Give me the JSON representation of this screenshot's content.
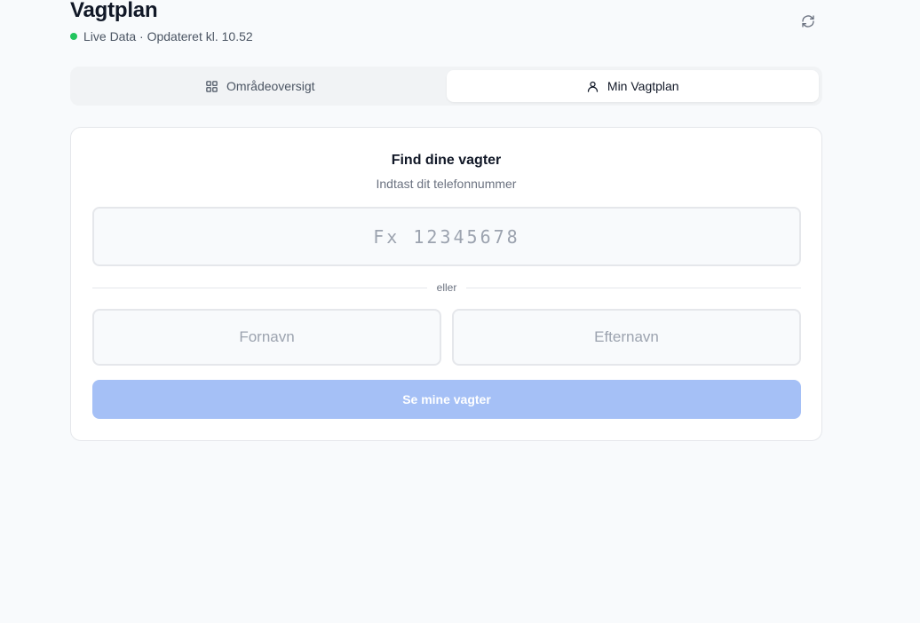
{
  "header": {
    "title": "Vagtplan",
    "status_text": "Live Data · Opdateret kl. 10.52",
    "status_color": "#22c55e",
    "refresh_icon": "refresh-icon"
  },
  "tabs": [
    {
      "label": "Områdeoversigt",
      "icon": "grid-icon",
      "active": false
    },
    {
      "label": "Min Vagtplan",
      "icon": "user-icon",
      "active": true
    }
  ],
  "card": {
    "title": "Find dine vagter",
    "subtitle": "Indtast dit telefonnummer",
    "phone_placeholder": "Fx 12345678",
    "phone_value": "",
    "divider_text": "eller",
    "first_name_placeholder": "Fornavn",
    "first_name_value": "",
    "last_name_placeholder": "Efternavn",
    "last_name_value": "",
    "submit_label": "Se mine vagter",
    "submit_color": "#a5c0f6"
  }
}
